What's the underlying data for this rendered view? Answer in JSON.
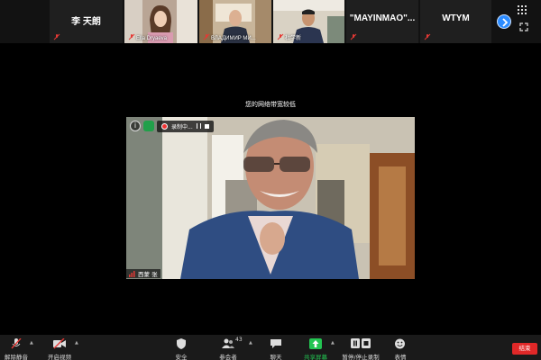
{
  "gallery": {
    "tiles": [
      {
        "name": "李 天朗",
        "type": "name"
      },
      {
        "name": "Ella Dryaeva",
        "type": "video"
      },
      {
        "name": "ВЛАДИМИР МИ...",
        "type": "video"
      },
      {
        "name": "杜学新",
        "type": "video"
      },
      {
        "name": "\"MAYINMAO\"...",
        "type": "name"
      },
      {
        "name": "WTYM",
        "type": "name"
      }
    ],
    "next_icon": "chevron-right-icon",
    "view_icon": "grid-view-icon",
    "fullscreen_icon": "fullscreen-icon"
  },
  "main": {
    "network_warning": "您的网络带宽较低",
    "recording_label": "录制中...",
    "speaker_name": "西蒙 张"
  },
  "toolbar": {
    "unmute": "解除静音",
    "start_video": "开启视频",
    "security": "安全",
    "participants": "参会者",
    "participant_count": "43",
    "chat": "聊天",
    "share_screen": "共享屏幕",
    "record": "暂停/停止录制",
    "reactions": "表情",
    "end": "结束"
  },
  "colors": {
    "accent": "#2d8cff",
    "share_green": "#23c552",
    "end_red": "#e02828",
    "muted_red": "#e53935"
  }
}
